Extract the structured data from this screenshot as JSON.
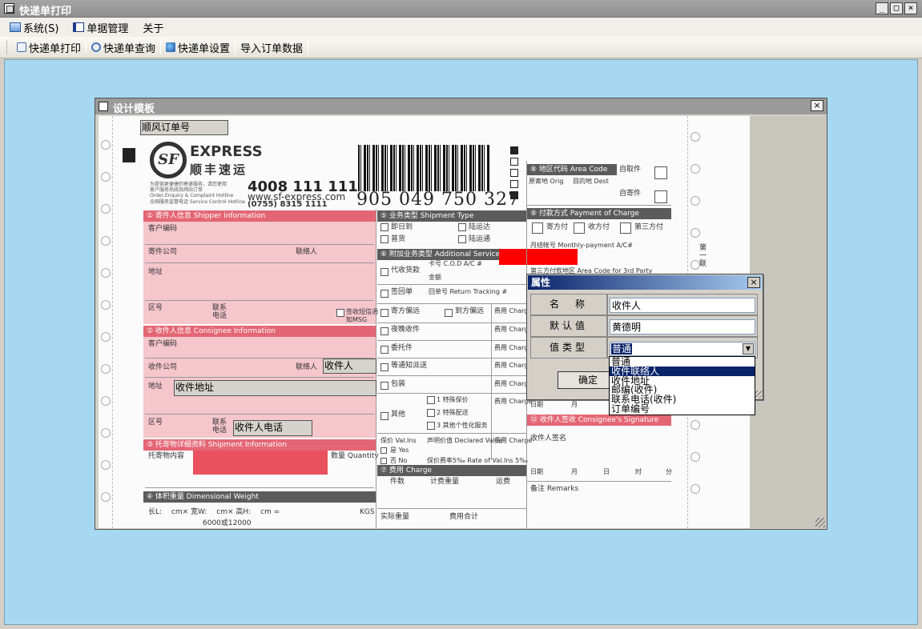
{
  "app": {
    "title": "快递单打印",
    "window_buttons": [
      "_",
      "□",
      "×"
    ]
  },
  "menu": {
    "items": [
      {
        "label": "系统(S)",
        "icon": "system-icon"
      },
      {
        "label": "单据管理",
        "icon": "document-icon"
      },
      {
        "label": "关于",
        "icon": ""
      }
    ]
  },
  "toolbar": {
    "items": [
      {
        "label": "快递单打印",
        "icon": "print-icon"
      },
      {
        "label": "快递单查询",
        "icon": "search-icon"
      },
      {
        "label": "快递单设置",
        "icon": "settings-icon"
      },
      {
        "label": "导入订单数据",
        "icon": ""
      }
    ]
  },
  "design_window": {
    "title": "设计模板",
    "close": "×"
  },
  "waybill": {
    "express": "EXPRESS",
    "brand_cn": "顺丰速运",
    "hotline": "4008 111 111",
    "website": "www.sf-express.com",
    "supervision": "(0755) 8315 1111",
    "hotline_note_1": "为提供更便捷的寄递服务，请您使用",
    "hotline_note_2": "客户服务热线及网站订单",
    "hotline_note_3": "Order,Enquiry & Complaint Hotline",
    "hotline_note_4": "全国服务监督电话 Service Control Hotline",
    "barcode_number": "905 049 750 327",
    "sections": {
      "shipper": "① 寄件人信息 Shipper information",
      "consignee": "② 收件人信息 Consignee Information",
      "goods": "③ 托寄物详细资料 Shipment Information",
      "dimension": "④ 体积重量 Dimensional Weight",
      "service": "⑤ 业务类型 Shipment Type",
      "additional": "⑥ 附加业务类型 Additional Service",
      "charge": "⑦ 费用 Charge",
      "area": "⑧ 地区代码 Area Code",
      "payment": "⑨ 付款方式 Payment of Charge",
      "signature": "⑫ 收件人签收 Consignee's Signature"
    },
    "labels": {
      "customer_no": "客户编码",
      "company": "寄件公司",
      "contact": "联络人",
      "address": "地址",
      "area_code": "区号",
      "tel": "联系电话",
      "notice": "签收短信通知MSG",
      "consignee_company": "收件公司",
      "goods_content": "托寄物内容",
      "quantity": "数量 Quantity",
      "dim_line": "长L:　 cm× 宽W:　 cm× 高H:　 cm =",
      "kgs": "KGS",
      "dim_formula": "6000或12000",
      "same_day": "即日到",
      "cargo": "普货",
      "overland": "陆运达",
      "ground": "陆运通",
      "cod": "代收货款",
      "cod_card": "卡号 C.O.D A/C #",
      "amount": "金额",
      "return_receipt": "签回单",
      "return_no": "回单号 Return Tracking #",
      "remote_shipper": "寄方偏远",
      "remote_consignee": "到方偏远",
      "fee_charge": "费用 Charge",
      "evening": "夜晚收件",
      "authorization": "委托件",
      "delivery_notice": "等通知派送",
      "package": "包装",
      "special_offer": "1 特殊保价",
      "special_delivery": "2 特殊配送",
      "personalized": "3 其他个性化服务",
      "other": "其他",
      "val_ins": "保价 Val.Ins",
      "declared": "声明价值 Declared Value",
      "yes": "是 Yes",
      "no": "否 No",
      "ins_rate": "保价费率5‰ Rate of Val.Ins 5‰",
      "pieces": "件数",
      "charged_weight": "计费重量",
      "freight": "运费",
      "actual_weight": "实际重量",
      "total_charge": "费用合计",
      "origin": "原寄地 Orig",
      "dest": "目的地 Dest",
      "self_pickup": "自取件",
      "self_send": "自寄件",
      "pay_shipper": "寄方付",
      "pay_consignee": "收方付",
      "pay_third": "第三方付",
      "monthly": "月结帐号 Monthly-payment A/C#",
      "third_area": "第三方付款地区 Area Code for 3rd Party",
      "date": "日期",
      "month": "月",
      "day": "日",
      "hour": "时",
      "minute": "分",
      "consignee_sign": "收件人签名",
      "remarks": "备注 Remarks",
      "copy_label": "第一联"
    }
  },
  "template_fields": {
    "order_no": "顺风订单号",
    "consignee": "收件人",
    "consignee_address": "收件地址",
    "consignee_phone": "收件人电话"
  },
  "property_dialog": {
    "title": "属性",
    "close": "×",
    "name_label": "名　称",
    "name_value": "收件人",
    "default_label": "默认值",
    "default_value": "黄德明",
    "type_label": "值类型",
    "type_value": "普通",
    "ok": "确定",
    "options": [
      "普通",
      "收件联络人",
      "收件地址",
      "邮编(收件)",
      "联系电话(收件)",
      "订单编号"
    ],
    "selected_option_index": 1
  },
  "colors": {
    "workspace_bg": "#a6d9f1",
    "selection": "#0a246a",
    "red_marker": "#ff0000",
    "section_pink": "#e46674"
  }
}
